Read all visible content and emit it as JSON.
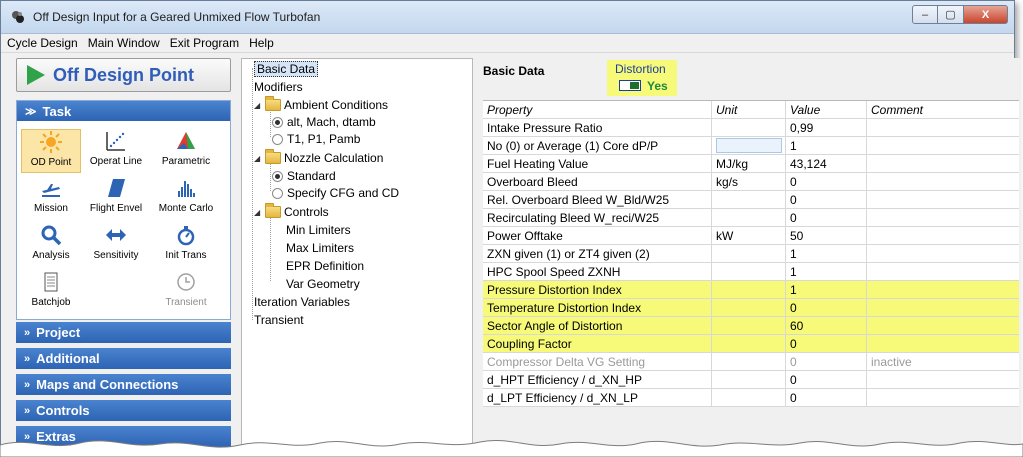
{
  "window": {
    "title": "Off Design Input for a Geared Unmixed Flow Turbofan"
  },
  "menu": [
    "Cycle Design",
    "Main Window",
    "Exit Program",
    "Help"
  ],
  "od_button": {
    "label": "Off Design Point"
  },
  "task": {
    "header": "Task",
    "items": [
      {
        "label": "OD Point",
        "icon": "sun-icon",
        "selected": true,
        "enabled": true
      },
      {
        "label": "Operat Line",
        "icon": "operating-line-icon",
        "selected": false,
        "enabled": true
      },
      {
        "label": "Parametric",
        "icon": "parametric-icon",
        "selected": false,
        "enabled": true
      },
      {
        "label": "Mission",
        "icon": "airplane-icon",
        "selected": false,
        "enabled": true
      },
      {
        "label": "Flight Envel",
        "icon": "flight-envelope-icon",
        "selected": false,
        "enabled": true
      },
      {
        "label": "Monte Carlo",
        "icon": "histogram-icon",
        "selected": false,
        "enabled": true
      },
      {
        "label": "Analysis",
        "icon": "magnifier-icon",
        "selected": false,
        "enabled": true
      },
      {
        "label": "Sensitivity",
        "icon": "double-arrow-icon",
        "selected": false,
        "enabled": true
      },
      {
        "label": "Init Trans",
        "icon": "stopwatch-icon",
        "selected": false,
        "enabled": true
      },
      {
        "label": "Batchjob",
        "icon": "document-icon",
        "selected": false,
        "enabled": true
      },
      {
        "label": "",
        "icon": "",
        "selected": false,
        "enabled": false
      },
      {
        "label": "Transient",
        "icon": "clock-icon",
        "selected": false,
        "enabled": false
      }
    ]
  },
  "sections": [
    "Project",
    "Additional",
    "Maps and Connections",
    "Controls",
    "Extras"
  ],
  "tree": {
    "basic_data": "Basic Data",
    "modifiers": "Modifiers",
    "ambient": "Ambient Conditions",
    "ambient_opt1": "alt, Mach, dtamb",
    "ambient_opt2": "T1, P1, Pamb",
    "nozzle": "Nozzle Calculation",
    "nozzle_opt1": "Standard",
    "nozzle_opt2": "Specify CFG and CD",
    "controls": "Controls",
    "min_limiters": "Min Limiters",
    "max_limiters": "Max Limiters",
    "epr": "EPR Definition",
    "var_geometry": "Var Geometry",
    "iteration": "Iteration Variables",
    "transient": "Transient"
  },
  "main": {
    "title": "Basic Data",
    "distortion_label": "Distortion",
    "distortion_value": "Yes",
    "columns": [
      "Property",
      "Unit",
      "Value",
      "Comment"
    ],
    "rows": [
      {
        "property": "Intake Pressure Ratio",
        "unit": "",
        "value": "0,99",
        "comment": "",
        "highlight": false,
        "disabled": false
      },
      {
        "property": "No (0) or Average (1) Core dP/P",
        "unit": "",
        "value": "1",
        "comment": "",
        "highlight": false,
        "disabled": false,
        "edit": true
      },
      {
        "property": "Fuel Heating Value",
        "unit": "MJ/kg",
        "value": "43,124",
        "comment": "",
        "highlight": false,
        "disabled": false
      },
      {
        "property": "Overboard Bleed",
        "unit": "kg/s",
        "value": "0",
        "comment": "",
        "highlight": false,
        "disabled": false
      },
      {
        "property": "Rel. Overboard Bleed W_Bld/W25",
        "unit": "",
        "value": "0",
        "comment": "",
        "highlight": false,
        "disabled": false
      },
      {
        "property": "Recirculating Bleed W_reci/W25",
        "unit": "",
        "value": "0",
        "comment": "",
        "highlight": false,
        "disabled": false
      },
      {
        "property": "Power Offtake",
        "unit": "kW",
        "value": "50",
        "comment": "",
        "highlight": false,
        "disabled": false
      },
      {
        "property": "ZXN given (1) or ZT4 given (2)",
        "unit": "",
        "value": "1",
        "comment": "",
        "highlight": false,
        "disabled": false
      },
      {
        "property": "HPC Spool Speed ZXNH",
        "unit": "",
        "value": "1",
        "comment": "",
        "highlight": false,
        "disabled": false
      },
      {
        "property": "Pressure Distortion Index",
        "unit": "",
        "value": "1",
        "comment": "",
        "highlight": true,
        "disabled": false
      },
      {
        "property": "Temperature Distortion Index",
        "unit": "",
        "value": "0",
        "comment": "",
        "highlight": true,
        "disabled": false
      },
      {
        "property": "Sector Angle of Distortion",
        "unit": "",
        "value": "60",
        "comment": "",
        "highlight": true,
        "disabled": false
      },
      {
        "property": "Coupling Factor",
        "unit": "",
        "value": "0",
        "comment": "",
        "highlight": true,
        "disabled": false
      },
      {
        "property": "Compressor Delta VG Setting",
        "unit": "",
        "value": "0",
        "comment": "inactive",
        "highlight": false,
        "disabled": true
      },
      {
        "property": "d_HPT Efficiency / d_XN_HP",
        "unit": "",
        "value": "0",
        "comment": "",
        "highlight": false,
        "disabled": false
      },
      {
        "property": "d_LPT Efficiency / d_XN_LP",
        "unit": "",
        "value": "0",
        "comment": "",
        "highlight": false,
        "disabled": false
      }
    ]
  },
  "colors": {
    "section_blue": "#2d64b4",
    "highlight_yellow": "#f6fa78",
    "od_text": "#2f5db8",
    "play_green": "#2fa24a"
  }
}
